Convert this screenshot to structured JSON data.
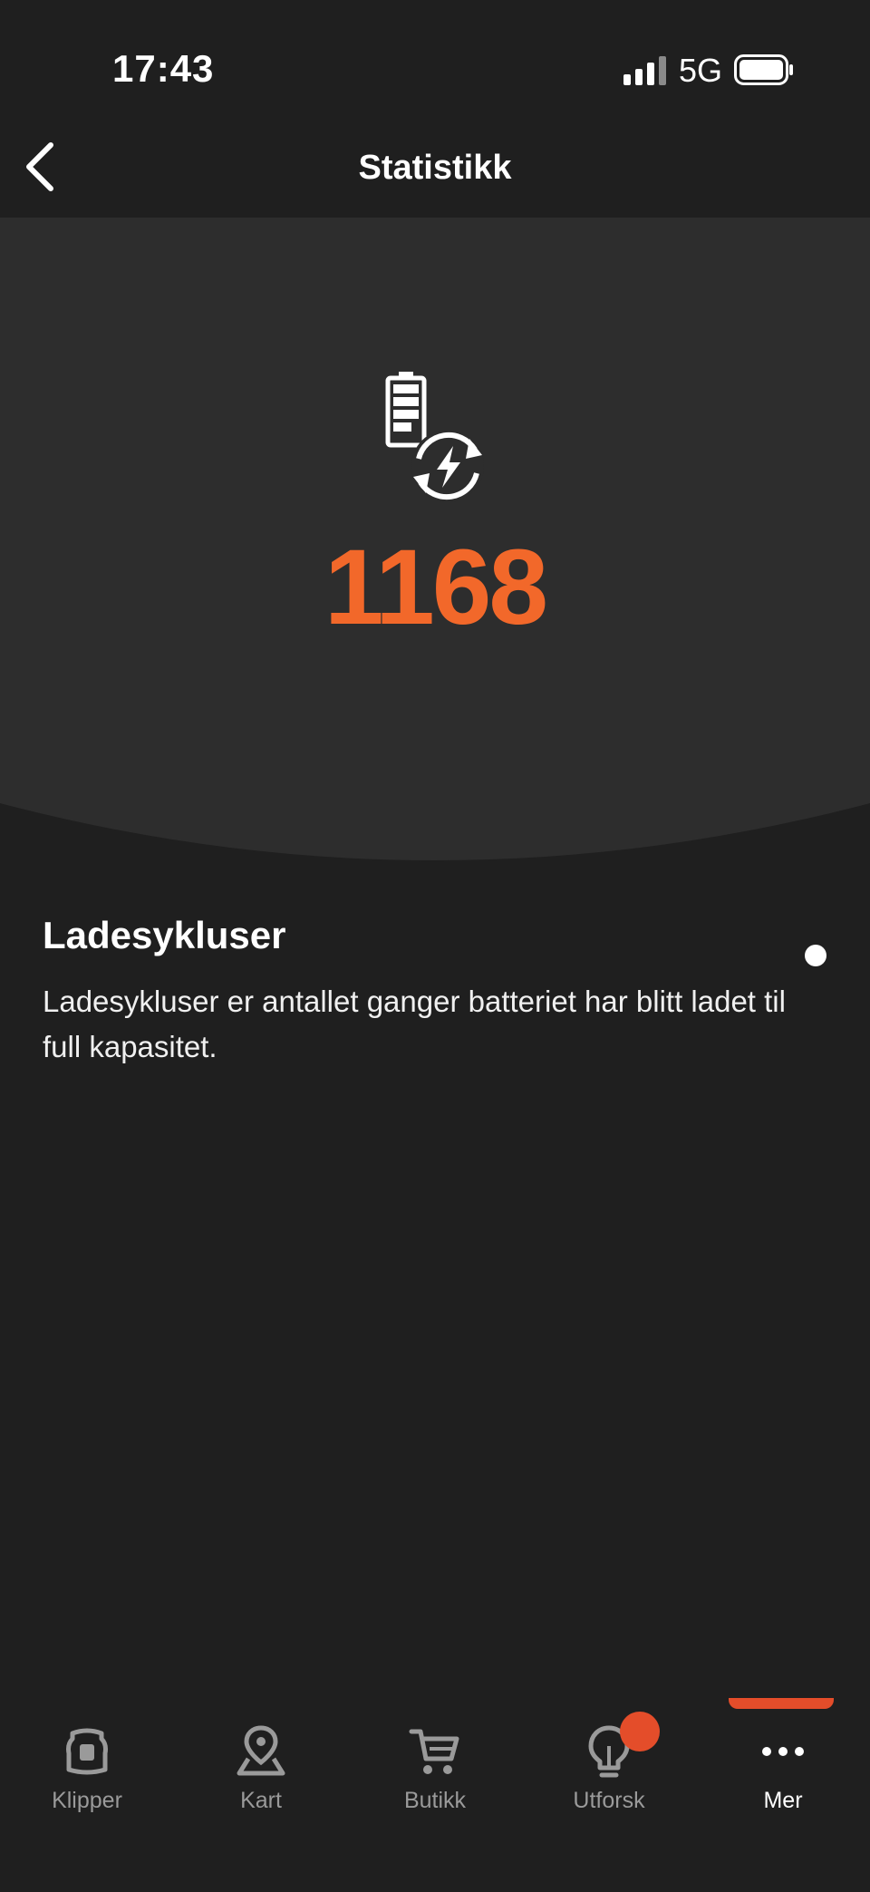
{
  "status_bar": {
    "time": "17:43",
    "network": "5G",
    "icons": [
      "signal-bars-icon",
      "battery-icon"
    ]
  },
  "header": {
    "title": "Statistikk",
    "back_icon": "chevron-left-icon"
  },
  "hero": {
    "icon": "battery-charge-cycle-icon",
    "value": "1168",
    "value_color": "#f2682a"
  },
  "info": {
    "title": "Ladesykluser",
    "description": "Ladesykluser er antallet ganger batteriet har blitt ladet til full kapasitet."
  },
  "tab_bar": {
    "items": [
      {
        "label": "Klipper",
        "icon": "mower-icon",
        "active": false
      },
      {
        "label": "Kart",
        "icon": "map-pin-icon",
        "active": false
      },
      {
        "label": "Butikk",
        "icon": "cart-icon",
        "active": false
      },
      {
        "label": "Utforsk",
        "icon": "lightbulb-icon",
        "active": false,
        "notification": true
      },
      {
        "label": "Mer",
        "icon": "more-dots-icon",
        "active": true
      }
    ],
    "accent_color": "#e44d2a"
  },
  "colors": {
    "background": "#1f1f1f",
    "hero_background": "#2d2d2d",
    "accent": "#f2682a"
  }
}
